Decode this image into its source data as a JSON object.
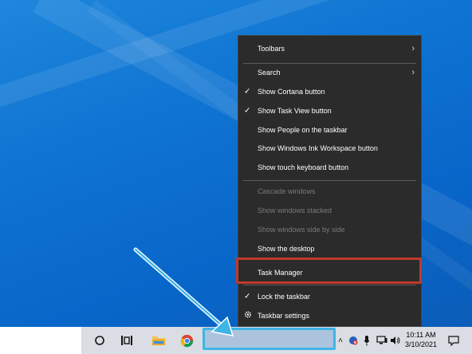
{
  "context_menu": {
    "items": [
      {
        "label": "Toolbars",
        "submenu": true
      },
      {
        "label": "Search",
        "submenu": true
      },
      {
        "label": "Show Cortana button",
        "checked": true
      },
      {
        "label": "Show Task View button",
        "checked": true
      },
      {
        "label": "Show People on the taskbar"
      },
      {
        "label": "Show Windows Ink Workspace button"
      },
      {
        "label": "Show touch keyboard button"
      },
      {
        "label": "Cascade windows",
        "disabled": true
      },
      {
        "label": "Show windows stacked",
        "disabled": true
      },
      {
        "label": "Show windows side by side",
        "disabled": true
      },
      {
        "label": "Show the desktop"
      },
      {
        "label": "Task Manager",
        "highlighted": true
      },
      {
        "label": "Lock the taskbar",
        "checked": true
      },
      {
        "label": "Taskbar settings",
        "icon": "gear-icon"
      }
    ]
  },
  "taskbar": {
    "time": "10:11 AM",
    "date": "3/10/2021",
    "pinned": [
      "cortana-icon",
      "task-view-icon",
      "file-explorer-icon",
      "chrome-icon"
    ],
    "tray_icons": [
      "chevron-up-icon",
      "network-error-icon",
      "microphone-icon",
      "display-icon",
      "volume-icon"
    ]
  },
  "annotation": {
    "arrow_color": "#3fb4e6",
    "highlight_color": "#c0392b"
  }
}
